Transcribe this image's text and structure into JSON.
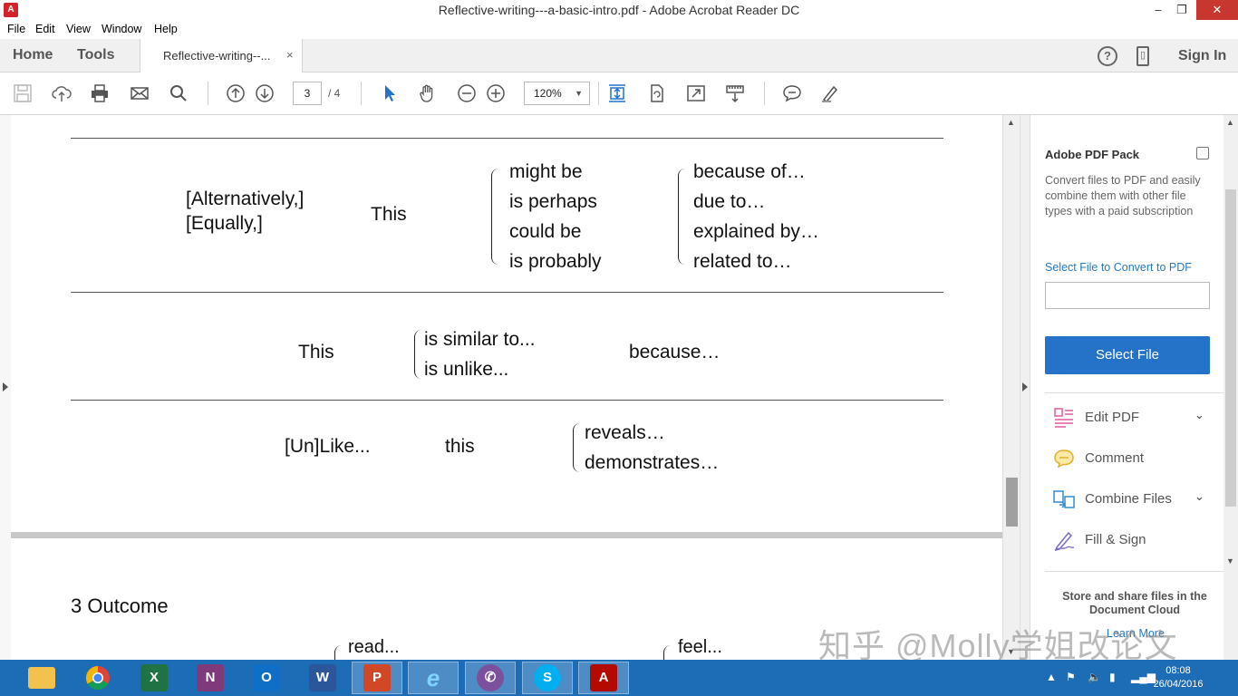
{
  "window": {
    "title": "Reflective-writing---a-basic-intro.pdf - Adobe Acrobat Reader DC",
    "minimize": "–",
    "maximize": "❐",
    "close": "✕"
  },
  "menu": [
    "File",
    "Edit",
    "View",
    "Window",
    "Help"
  ],
  "tabs": {
    "home": "Home",
    "tools": "Tools",
    "document": "Reflective-writing--...",
    "close": "×",
    "help": "?",
    "mobile": "▯",
    "sign_in": "Sign In"
  },
  "toolbar": {
    "page_current": "3",
    "page_total": "/ 4",
    "zoom": "120%"
  },
  "document": {
    "table_row1": {
      "lead": [
        "[Alternatively,]",
        "[Equally,]"
      ],
      "subject": "This",
      "options_a": [
        "might be",
        "is perhaps",
        "could be",
        "is probably"
      ],
      "options_b": [
        "because of…",
        "due to…",
        "explained by…",
        "related to…"
      ]
    },
    "table_row2": {
      "subject": "This",
      "options": [
        "is similar to...",
        "is unlike..."
      ],
      "tail": "because…"
    },
    "table_row3": {
      "lead": "[Un]Like...",
      "subject": "this",
      "options": [
        "reveals…",
        "demonstrates…"
      ]
    },
    "section_heading": "3 Outcome",
    "bottom_left": "read...",
    "bottom_right": "feel..."
  },
  "right_panel": {
    "title": "Adobe PDF Pack",
    "description": "Convert files to PDF and easily combine them with other file types with a paid subscription",
    "convert_link": "Select File to Convert to PDF",
    "select_button": "Select File",
    "tools": [
      {
        "label": "Edit PDF",
        "icon": "edit-pdf-icon",
        "expandable": true
      },
      {
        "label": "Comment",
        "icon": "comment-icon",
        "expandable": false
      },
      {
        "label": "Combine Files",
        "icon": "combine-files-icon",
        "expandable": true
      },
      {
        "label": "Fill & Sign",
        "icon": "fill-sign-icon",
        "expandable": false
      }
    ],
    "cloud_text": "Store and share files in the Document Cloud",
    "learn_more": "Learn More"
  },
  "watermark": "知乎 @Molly学姐改论文",
  "taskbar": {
    "apps": [
      "File Explorer",
      "Chrome",
      "Excel",
      "OneNote",
      "Outlook",
      "Word",
      "PowerPoint",
      "Internet Explorer",
      "Viber",
      "Skype",
      "Acrobat Reader"
    ],
    "time": "08:08",
    "date": "26/04/2016"
  },
  "colors": {
    "accent_blue": "#2473c8",
    "taskbar": "#1d6cb6",
    "close_red": "#c7372f"
  }
}
